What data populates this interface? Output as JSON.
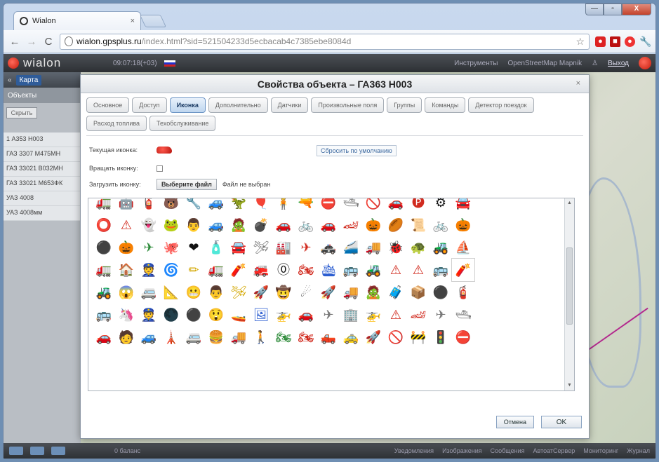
{
  "browser": {
    "tab_title": "Wialon",
    "tab_close": "×",
    "url_host": "wialon.gpsplus.ru",
    "url_rest": "/index.html?sid=521504233d5ecbacab4c7385ebe8084d",
    "window_controls": {
      "minimize": "—",
      "close": "X"
    }
  },
  "app": {
    "logo": "wialon",
    "clock": "09:07:18(+03)",
    "top_right": [
      "Инструменты",
      "OpenStreetMap Mapnik"
    ],
    "logout": "Выход",
    "map_button": "Карта",
    "objects_header": "Объекты",
    "show_button": "Скрыть",
    "units": [
      "1 А353 Н003",
      "ГАЗ 3307 М475МН",
      "ГАЗ 33021 В032МН",
      "ГАЗ 33021 М653ФК",
      "УАЗ 4008",
      "УАЗ 4008мм"
    ],
    "bottom_left": "0 баланс",
    "bottom_items": [
      "Уведомления",
      "Изображения",
      "Сообщения",
      "АвтоатСервер",
      "Мониторинг",
      "Журнал"
    ]
  },
  "dialog": {
    "title": "Свойства объекта – ГА363 Н003",
    "close": "×",
    "tabs": [
      {
        "label": "Основное",
        "active": false
      },
      {
        "label": "Доступ",
        "active": false
      },
      {
        "label": "Иконка",
        "active": true
      },
      {
        "label": "Дополнительно",
        "active": false
      },
      {
        "label": "Датчики",
        "active": false
      },
      {
        "label": "Произвольные поля",
        "active": false
      },
      {
        "label": "Группы",
        "active": false
      },
      {
        "label": "Команды",
        "active": false
      },
      {
        "label": "Детектор поездок",
        "active": false
      },
      {
        "label": "Расход топлива",
        "active": false
      },
      {
        "label": "Техобслуживание",
        "active": false
      }
    ],
    "current_icon_label": "Текущая иконка:",
    "reset_button": "Сбросить по умолчанию",
    "rotate_label": "Вращать иконку:",
    "upload_label": "Загрузить иконку:",
    "choose_file_button": "Выберите файл",
    "no_file_text": "Файл не выбран",
    "cancel_button": "Отмена",
    "ok_button": "OK"
  },
  "icons": [
    [
      "🚛",
      "c-green"
    ],
    [
      "🤖",
      "c-black"
    ],
    [
      "🧯",
      "c-blue"
    ],
    [
      "🐻",
      "c-brown"
    ],
    [
      "🔧",
      "c-gray"
    ],
    [
      "🚙",
      "c-green"
    ],
    [
      "🦖",
      "c-green"
    ],
    [
      "🎈",
      "c-yellow"
    ],
    [
      "🧍",
      "c-red"
    ],
    [
      "🔫",
      "c-red"
    ],
    [
      "⛔",
      "c-red"
    ],
    [
      "🛥",
      "c-gray"
    ],
    [
      "🚫",
      "c-red"
    ],
    [
      "🚗",
      "c-blue"
    ],
    [
      "🅟",
      "c-red"
    ],
    [
      "⚙",
      "c-black"
    ],
    [
      "🚘",
      "c-blue"
    ],
    [
      "",
      ""
    ],
    [
      "",
      ""
    ],
    [
      "",
      ""
    ],
    [
      "⭕",
      "c-red"
    ],
    [
      "⚠",
      "c-red"
    ],
    [
      "👻",
      "c-blue"
    ],
    [
      "🐸",
      "c-blue"
    ],
    [
      "👨",
      "c-black"
    ],
    [
      "🚙",
      "c-green"
    ],
    [
      "🧟",
      "c-green"
    ],
    [
      "💣",
      "c-black"
    ],
    [
      "🚗",
      "c-blue"
    ],
    [
      "🚲",
      "c-gray"
    ],
    [
      "🚗",
      "c-blue"
    ],
    [
      "🏎",
      "c-red"
    ],
    [
      "🎃",
      "c-orange"
    ],
    [
      "🏉",
      "c-orange"
    ],
    [
      "📜",
      "c-brown"
    ],
    [
      "🚲",
      "c-gray"
    ],
    [
      "🎃",
      "c-orange"
    ],
    [
      "",
      ""
    ],
    [
      "",
      ""
    ],
    [
      "",
      ""
    ],
    [
      "⚫",
      "c-black"
    ],
    [
      "🎃",
      "c-orange"
    ],
    [
      "✈",
      "c-green"
    ],
    [
      "🐙",
      "c-red"
    ],
    [
      "❤",
      "c-black"
    ],
    [
      "🧴",
      "c-orange"
    ],
    [
      "🚘",
      "c-blue"
    ],
    [
      "🛩",
      "c-gray"
    ],
    [
      "🏭",
      "c-gray"
    ],
    [
      "✈",
      "c-red"
    ],
    [
      "🚓",
      "c-gray"
    ],
    [
      "🚄",
      "c-red"
    ],
    [
      "🚚",
      "c-blue"
    ],
    [
      "🐞",
      "c-black"
    ],
    [
      "🐢",
      "c-green"
    ],
    [
      "🚜",
      "c-gray"
    ],
    [
      "⛵",
      "c-yellow"
    ],
    [
      "",
      ""
    ],
    [
      "",
      ""
    ],
    [
      "",
      ""
    ],
    [
      "🚛",
      "c-red"
    ],
    [
      "🏠",
      "c-red"
    ],
    [
      "👮",
      "c-brown"
    ],
    [
      "🌀",
      "c-gray"
    ],
    [
      "✏",
      "c-yellow"
    ],
    [
      "🚛",
      "c-red"
    ],
    [
      "🧨",
      "c-gray"
    ],
    [
      "🚒",
      "c-green"
    ],
    [
      "⓪",
      "c-black"
    ],
    [
      "🏍",
      "c-red"
    ],
    [
      "🛳",
      "c-blue"
    ],
    [
      "🚌",
      "c-yellow"
    ],
    [
      "🚜",
      "c-green"
    ],
    [
      "⚠",
      "c-red"
    ],
    [
      "⚠",
      "c-red"
    ],
    [
      "🚌",
      "c-red"
    ],
    [
      "🧨",
      "c-red"
    ],
    [
      "",
      ""
    ],
    [
      "",
      ""
    ],
    [
      "",
      ""
    ],
    [
      "🚜",
      "c-green"
    ],
    [
      "😱",
      "c-black"
    ],
    [
      "🚐",
      "c-red"
    ],
    [
      "📐",
      "c-yellow"
    ],
    [
      "😬",
      "c-black"
    ],
    [
      "👨",
      "c-gray"
    ],
    [
      "🛩",
      "c-yellow"
    ],
    [
      "🚀",
      "c-gray"
    ],
    [
      "🤠",
      "c-yellow"
    ],
    [
      "☄",
      "c-gray"
    ],
    [
      "🚀",
      "c-gray"
    ],
    [
      "🚚",
      "c-red"
    ],
    [
      "🧟",
      "c-red"
    ],
    [
      "🧳",
      "c-orange"
    ],
    [
      "📦",
      "c-blue"
    ],
    [
      "⚫",
      "c-gray"
    ],
    [
      "🧯",
      "c-red"
    ],
    [
      "",
      ""
    ],
    [
      "",
      ""
    ],
    [
      "",
      ""
    ],
    [
      "🚌",
      "c-yellow"
    ],
    [
      "🦄",
      "c-orange"
    ],
    [
      "👮",
      "c-blue"
    ],
    [
      "🌑",
      "c-red"
    ],
    [
      "⚫",
      "c-black"
    ],
    [
      "😲",
      "c-red"
    ],
    [
      "🚤",
      "c-blue"
    ],
    [
      "🖼",
      "c-blue"
    ],
    [
      "🚁",
      "c-gray"
    ],
    [
      "🚗",
      "c-red"
    ],
    [
      "✈",
      "c-gray"
    ],
    [
      "🏢",
      "c-blue"
    ],
    [
      "🚁",
      "c-red"
    ],
    [
      "⚠",
      "c-red"
    ],
    [
      "🏎",
      "c-red"
    ],
    [
      "✈",
      "c-gray"
    ],
    [
      "🛥",
      "c-gray"
    ],
    [
      "",
      ""
    ],
    [
      "",
      ""
    ],
    [
      "",
      ""
    ],
    [
      "🚗",
      "c-blue"
    ],
    [
      "🧑",
      "c-gray"
    ],
    [
      "🚙",
      "c-gray"
    ],
    [
      "🗼",
      "c-gray"
    ],
    [
      "🚐",
      "c-gray"
    ],
    [
      "🍔",
      "c-orange"
    ],
    [
      "🚚",
      "c-yellow"
    ],
    [
      "🚶",
      "c-blue"
    ],
    [
      "🏍",
      "c-green"
    ],
    [
      "🏍",
      "c-red"
    ],
    [
      "🛻",
      "c-gray"
    ],
    [
      "🚕",
      "c-yellow"
    ],
    [
      "🚀",
      "c-blue"
    ],
    [
      "🚫",
      "c-red"
    ],
    [
      "🚧",
      "c-blue"
    ],
    [
      "🚦",
      "c-red"
    ],
    [
      "⛔",
      "c-red"
    ],
    [
      "",
      ""
    ],
    [
      "",
      ""
    ],
    [
      "",
      ""
    ]
  ]
}
